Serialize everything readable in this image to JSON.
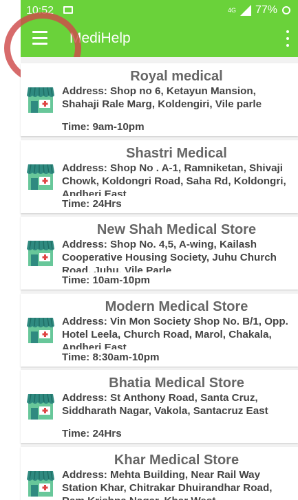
{
  "status_bar": {
    "time": "10:52",
    "signal_label": "4G",
    "battery": "77%"
  },
  "toolbar": {
    "title": "MediHelp"
  },
  "colors": {
    "primary": "#6ad23a",
    "highlight_ring": "#d05050",
    "store_roof": "#2f8a80",
    "store_body": "#68c79a"
  },
  "icons": {
    "menu": "hamburger-menu-icon",
    "overflow": "more-vert-icon",
    "store": "pharmacy-store-icon"
  },
  "stores": [
    {
      "name": "Royal medical",
      "address": "Address: Shop no 6, Ketayun Mansion, Shahaji Rale Marg, Koldengiri, Vile parle",
      "time": "Time: 9am-10pm"
    },
    {
      "name": "Shastri Medical",
      "address": "Address: Shop No . A-1, Ramniketan, Shivaji Chowk, Koldongri Road, Saha Rd, Koldongri, Andheri East",
      "time": "Time: 24Hrs"
    },
    {
      "name": "New Shah Medical Store",
      "address": "Address: Shop No. 4,5, A-wing, Kailash Cooperative Housing Society, Juhu Church Road, Juhu, Vile Parle",
      "time": "Time: 10am-10pm"
    },
    {
      "name": "Modern Medical Store",
      "address": "Address: Vin Mon Society Shop No. B/1, Opp. Hotel Leela, Church Road, Marol, Chakala, Andheri East",
      "time": "Time: 8:30am-10pm"
    },
    {
      "name": "Bhatia Medical Store",
      "address": "Address: St Anthony Road, Santa Cruz, Siddharath Nagar, Vakola, Santacruz East",
      "time": "Time: 24Hrs"
    },
    {
      "name": "Khar Medical Store",
      "address": "Address: Mehta Building, Near Rail Way Station Khar, Chitrakar Dhuirandhar Road, Ram Krishna Nagar, Khar West",
      "time": ""
    }
  ]
}
